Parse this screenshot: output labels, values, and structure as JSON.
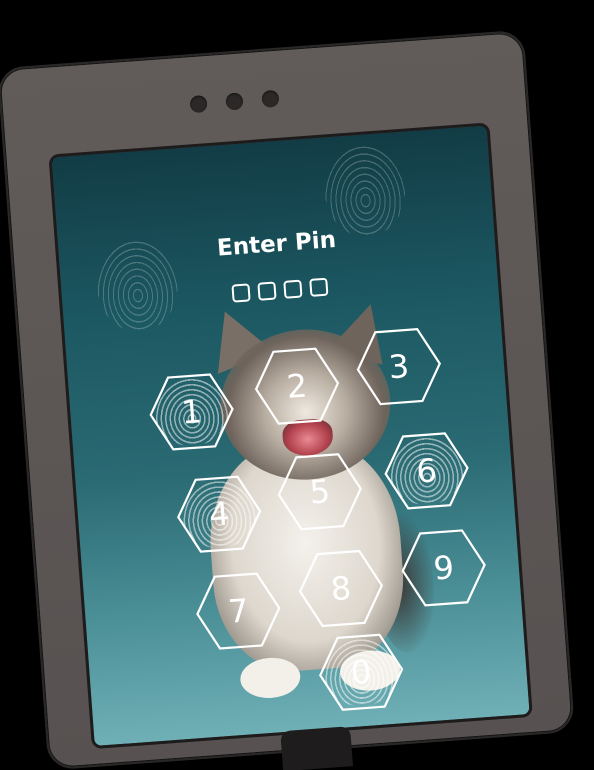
{
  "lock_screen": {
    "title": "Enter Pin",
    "pin_length": 4,
    "entered_digits": 0,
    "accent_color": "#ffffff",
    "background_colors": [
      "#123c45",
      "#2a6a73",
      "#6fb0b6"
    ]
  },
  "keypad": {
    "keys": [
      {
        "label": "1",
        "fingerprint": true
      },
      {
        "label": "2",
        "fingerprint": false
      },
      {
        "label": "3",
        "fingerprint": false
      },
      {
        "label": "4",
        "fingerprint": true
      },
      {
        "label": "5",
        "fingerprint": false
      },
      {
        "label": "6",
        "fingerprint": true
      },
      {
        "label": "7",
        "fingerprint": false
      },
      {
        "label": "8",
        "fingerprint": false
      },
      {
        "label": "9",
        "fingerprint": false
      },
      {
        "label": "0",
        "fingerprint": true
      }
    ]
  },
  "device": {
    "frame_color": "#5d5756",
    "camera_dots": 3,
    "home_button_icon": "home-button"
  }
}
